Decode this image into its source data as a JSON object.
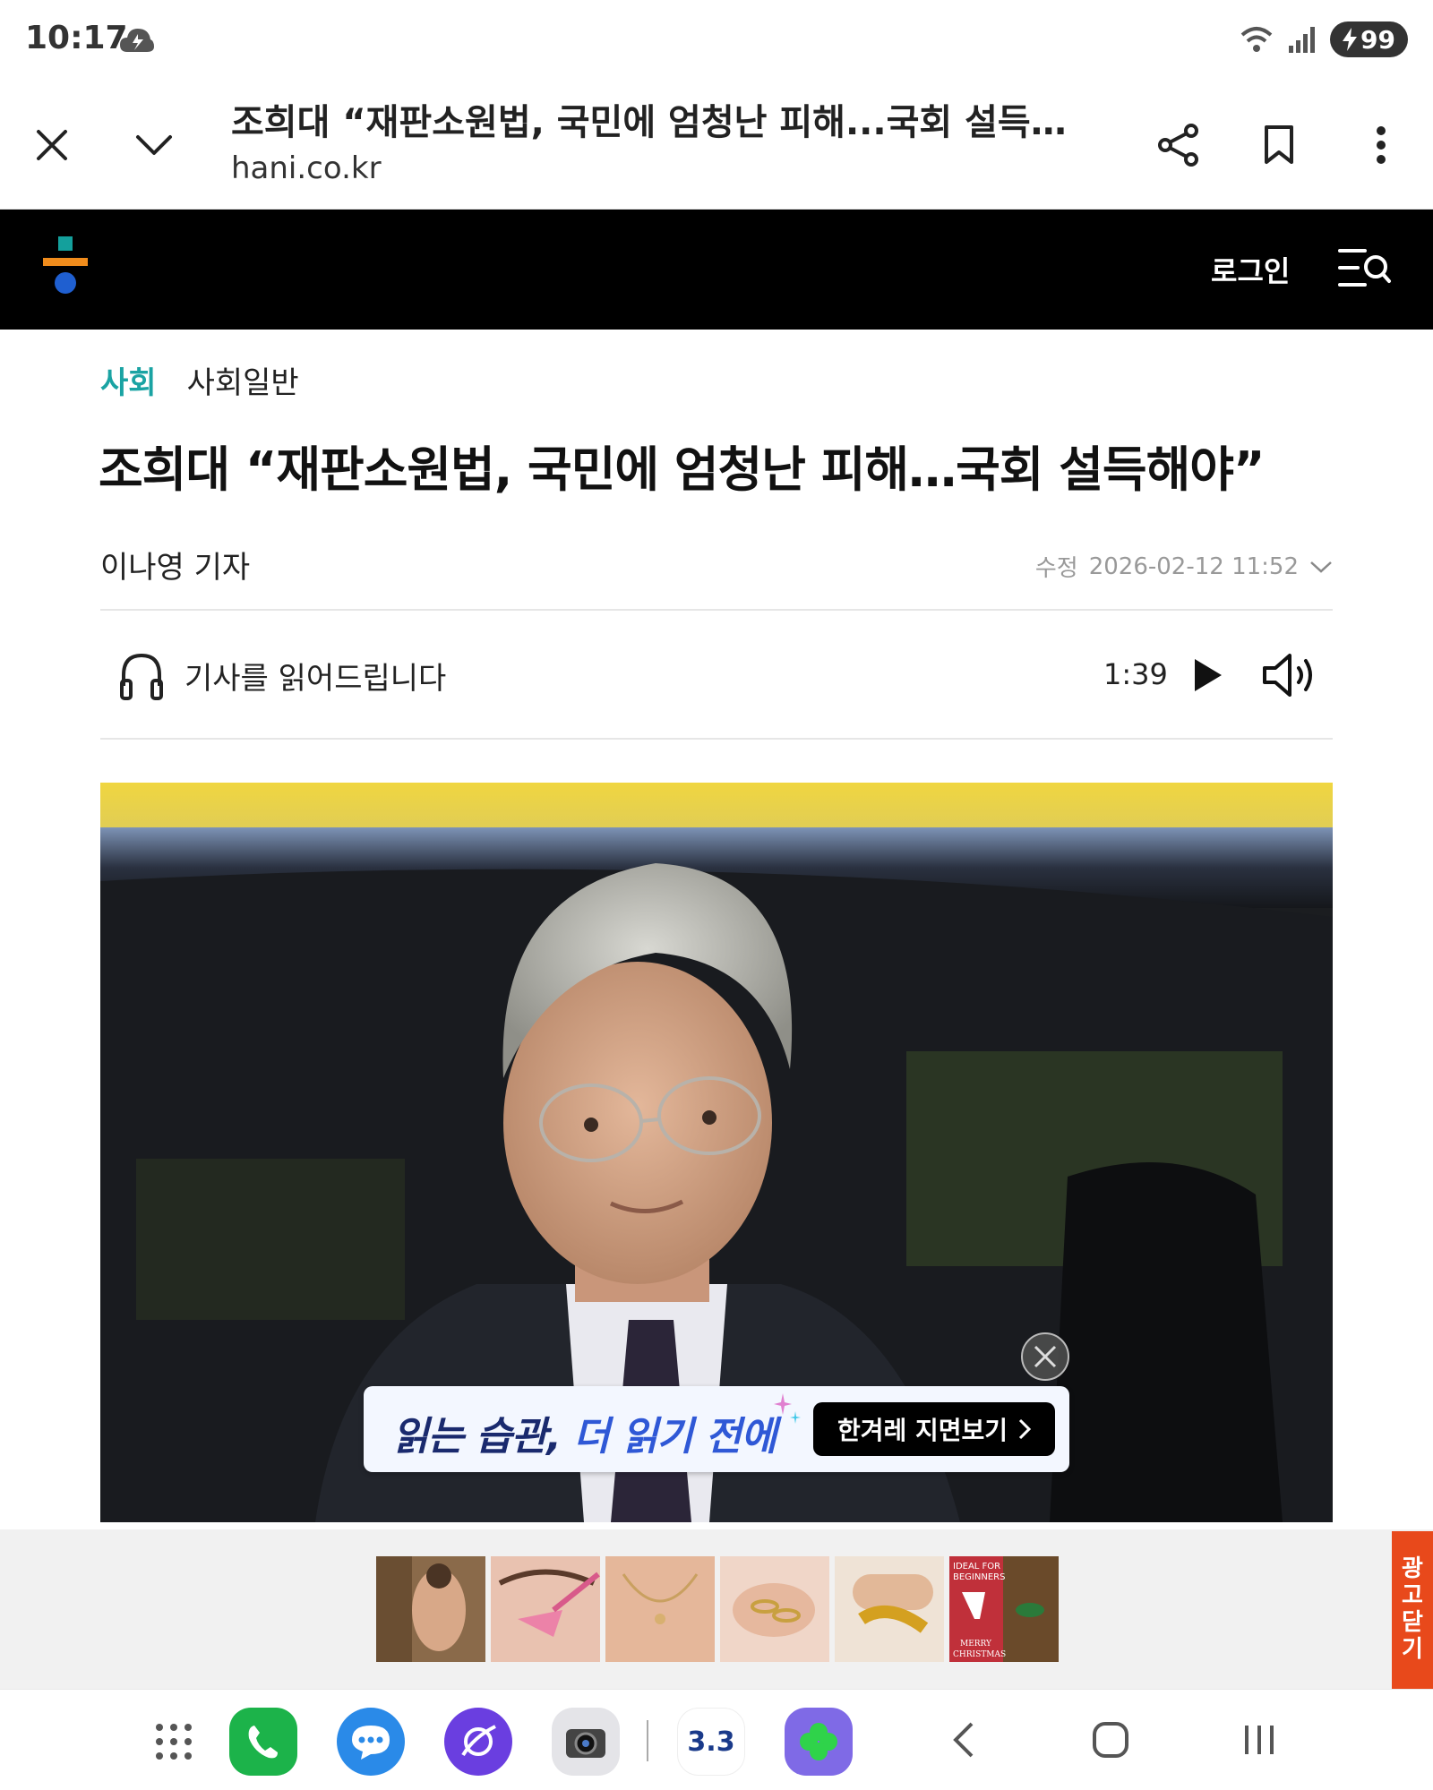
{
  "status_bar": {
    "time": "10:17",
    "battery": "99"
  },
  "browser": {
    "page_title": "조희대 “재판소원법, 국민에 엄청난 피해...국회 설득해...",
    "url": "hani.co.kr"
  },
  "site_header": {
    "login_label": "로그인"
  },
  "article": {
    "section": "사회",
    "subsection": "사회일반",
    "headline": "조희대 “재판소원법, 국민에 엄청난 피해…국회 설득해야”",
    "author": "이나영 기자",
    "modified_label": "수정",
    "modified_date": "2026-02-12 11:52"
  },
  "audio": {
    "label": "기사를 읽어드립니다",
    "duration": "1:39"
  },
  "promo": {
    "text_part1": "읽는 습관,",
    "text_part2": "더 읽기 전에",
    "button_label": "한겨레 지면보기"
  },
  "ad": {
    "close_label_lines": [
      "광",
      "고",
      "닫",
      "기"
    ],
    "thumb6_text1": "IDEAL FOR",
    "thumb6_text2": "BEGINNERS",
    "thumb6_text3": "MERRY",
    "thumb6_text4": "CHRISTMAS"
  },
  "dock": {
    "calendar_label": "3.3"
  },
  "colors": {
    "section_accent": "#1aa3a3",
    "ad_close": "#e8491b",
    "logo_orange": "#f08c1c",
    "logo_blue": "#1f5fd0",
    "logo_teal": "#14a09c"
  }
}
